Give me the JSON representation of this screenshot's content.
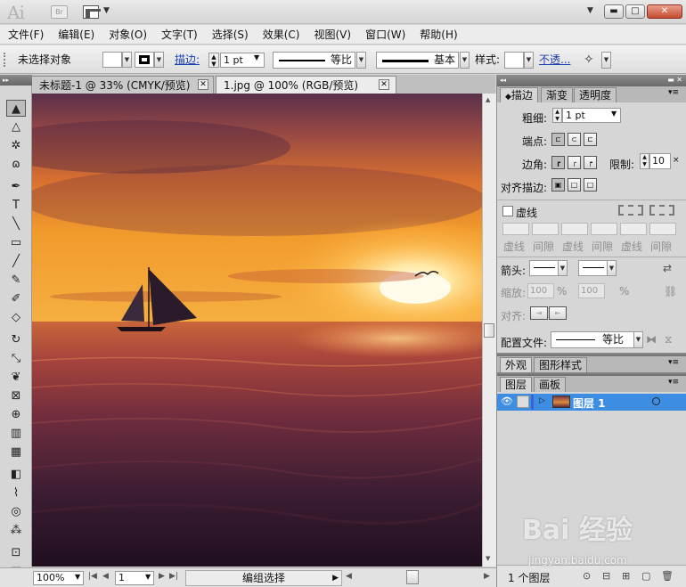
{
  "app": {
    "logo": "Ai",
    "bridge": "Br",
    "window_buttons": {
      "minimize": "▬",
      "maximize": "□",
      "close": "✕"
    }
  },
  "menu": [
    "文件(F)",
    "编辑(E)",
    "对象(O)",
    "文字(T)",
    "选择(S)",
    "效果(C)",
    "视图(V)",
    "窗口(W)",
    "帮助(H)"
  ],
  "control": {
    "selection_status": "未选择对象",
    "stroke_label": "描边:",
    "stroke_weight": "1 pt",
    "profile_label": "等比",
    "brush_label": "基本",
    "style_label": "样式:",
    "opacity_label": "不透..."
  },
  "doc_tabs": [
    {
      "title": "未标题-1 @ 33% (CMYK/预览)",
      "active": false
    },
    {
      "title": "1.jpg @ 100% (RGB/预览)",
      "active": true
    }
  ],
  "tools": [
    {
      "icon": "selection-tool-icon",
      "glyph": "▲",
      "selected": true
    },
    {
      "icon": "direct-selection-tool-icon",
      "glyph": "△",
      "selected": false
    },
    {
      "icon": "magic-wand-tool-icon",
      "glyph": "✲",
      "selected": false
    },
    {
      "icon": "lasso-tool-icon",
      "glyph": "ɷ",
      "selected": false
    },
    {
      "icon": "pen-tool-icon",
      "glyph": "✒",
      "selected": false
    },
    {
      "icon": "type-tool-icon",
      "glyph": "T",
      "selected": false
    },
    {
      "icon": "line-segment-tool-icon",
      "glyph": "╲",
      "selected": false
    },
    {
      "icon": "rectangle-tool-icon",
      "glyph": "▭",
      "selected": false
    },
    {
      "icon": "paintbrush-tool-icon",
      "glyph": "╱",
      "selected": false
    },
    {
      "icon": "pencil-tool-icon",
      "glyph": "✎",
      "selected": false
    },
    {
      "icon": "blob-brush-tool-icon",
      "glyph": "✐",
      "selected": false
    },
    {
      "icon": "eraser-tool-icon",
      "glyph": "◇",
      "selected": false
    },
    {
      "icon": "rotate-tool-icon",
      "glyph": "↻",
      "selected": false
    },
    {
      "icon": "scale-tool-icon",
      "glyph": "⤡",
      "selected": false
    },
    {
      "icon": "warp-tool-icon",
      "glyph": "❦",
      "selected": false
    },
    {
      "icon": "free-transform-tool-icon",
      "glyph": "⊠",
      "selected": false
    },
    {
      "icon": "shape-builder-tool-icon",
      "glyph": "⊕",
      "selected": false
    },
    {
      "icon": "column-graph-tool-icon",
      "glyph": "▥",
      "selected": false
    },
    {
      "icon": "mesh-tool-icon",
      "glyph": "▦",
      "selected": false
    },
    {
      "icon": "gradient-tool-icon",
      "glyph": "◧",
      "selected": false
    },
    {
      "icon": "eyedropper-tool-icon",
      "glyph": "⌇",
      "selected": false
    },
    {
      "icon": "blend-tool-icon",
      "glyph": "◎",
      "selected": false
    },
    {
      "icon": "symbol-sprayer-tool-icon",
      "glyph": "⁂",
      "selected": false
    },
    {
      "icon": "artboard-tool-icon",
      "glyph": "⊡",
      "selected": false
    },
    {
      "icon": "slice-tool-icon",
      "glyph": "▤",
      "selected": false
    }
  ],
  "status": {
    "zoom": "100%",
    "page": "1",
    "mode": "编组选择"
  },
  "stroke_panel": {
    "tabs": [
      "描边",
      "渐变",
      "透明度"
    ],
    "weight_label": "粗细:",
    "weight_value": "1 pt",
    "cap_label": "端点:",
    "corner_label": "边角:",
    "limit_label": "限制:",
    "limit_value": "10",
    "align_label": "对齐描边:",
    "dashed_label": "虚线",
    "dash_labels": [
      "虚线",
      "间隙",
      "虚线",
      "间隙",
      "虚线",
      "间隙"
    ],
    "arrow_label": "箭头:",
    "scale_label": "缩放:",
    "scale_start": "100",
    "scale_end": "100",
    "percent": "%",
    "align_arrow_label": "对齐:",
    "profile_label": "配置文件:",
    "profile_value": "等比"
  },
  "appearance_tabs": [
    "外观",
    "图形样式"
  ],
  "layers_tabs": [
    "图层",
    "画板"
  ],
  "layers": [
    {
      "name": "图层 1"
    }
  ],
  "layers_footer": {
    "count": "1 个图层"
  },
  "watermark": {
    "text": "Bai 经验",
    "url": "jingyan.baidu.com"
  },
  "colors": {
    "layer_selected": "#3d8ee3",
    "link_blue": "#1a3fb0"
  }
}
